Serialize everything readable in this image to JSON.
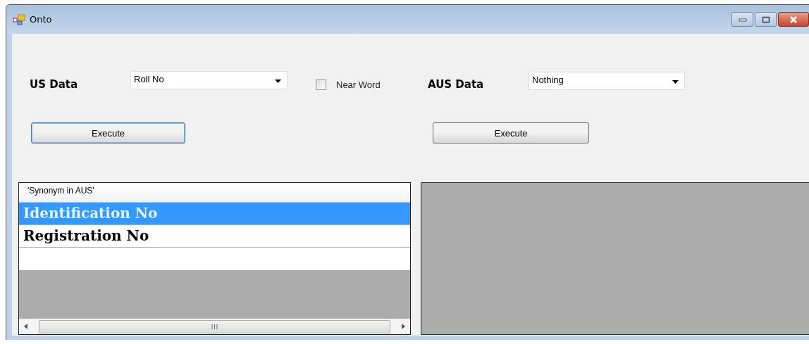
{
  "window": {
    "title": "Onto"
  },
  "us_data": {
    "label": "US Data",
    "value": "Roll No"
  },
  "near_word": {
    "label": "Near Word",
    "checked": false
  },
  "aus_data": {
    "label": "AUS Data",
    "value": "Nothing"
  },
  "execute_buttons": [
    {
      "label": "Execute",
      "focused": true
    },
    {
      "label": "Execute",
      "focused": false
    }
  ],
  "grid": {
    "column": "'Synonym in AUS'",
    "rows": [
      {
        "text": "Identification No",
        "selected": true
      },
      {
        "text": "Registration No",
        "selected": false
      }
    ]
  }
}
